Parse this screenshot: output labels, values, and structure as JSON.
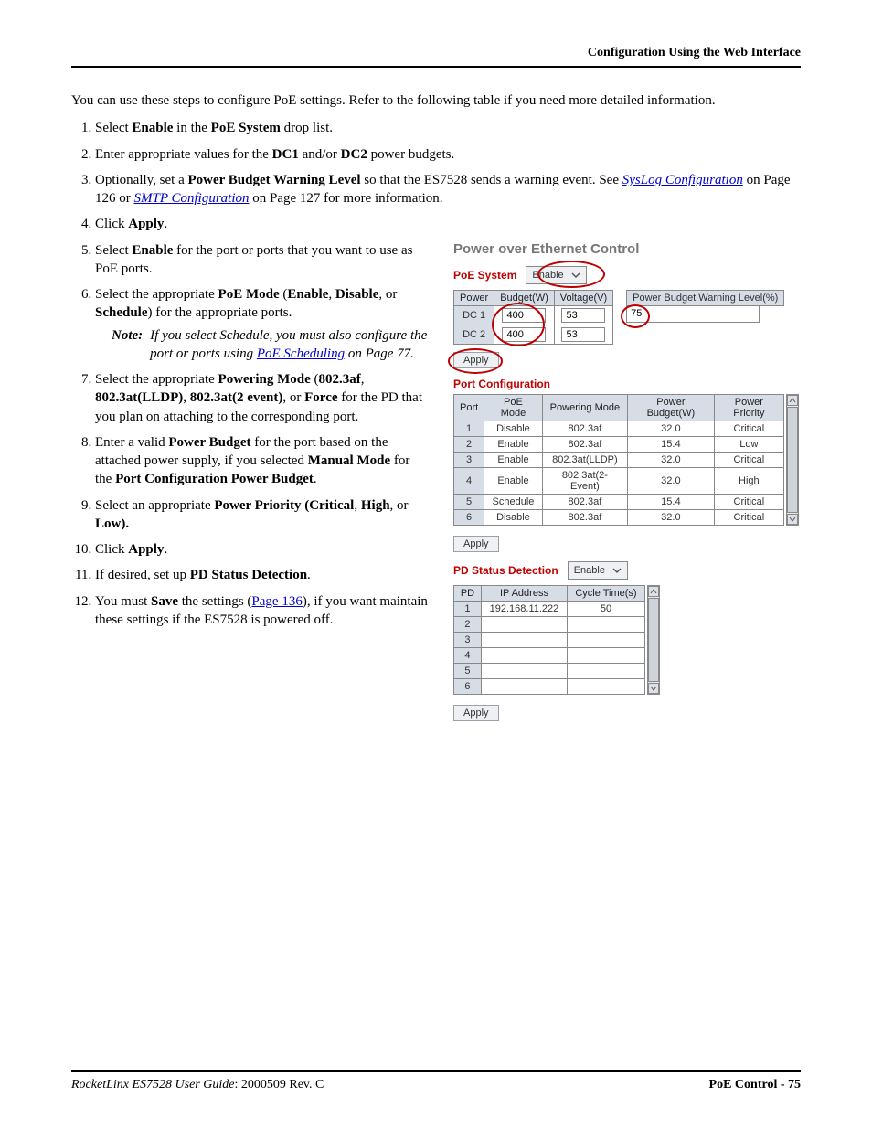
{
  "header": {
    "right": "Configuration Using the Web Interface"
  },
  "intro": "You can use these steps to configure PoE settings. Refer to the following table if you need more detailed information.",
  "links": {
    "syslog": "SysLog Configuration",
    "smtp": "SMTP Configuration",
    "poe_sched": "PoE Scheduling",
    "page136": "Page 136"
  },
  "steps_top": {
    "s1_a": "Select ",
    "s1_b": "Enable",
    "s1_c": " in the ",
    "s1_d": "PoE System",
    "s1_e": " drop list.",
    "s2_a": "Enter appropriate values for the ",
    "s2_b": "DC1",
    "s2_c": " and/or ",
    "s2_d": "DC2",
    "s2_e": " power budgets.",
    "s3_a": "Optionally, set a ",
    "s3_b": "Power Budget Warning Level",
    "s3_c": " so that the ES7528 sends a warning event. See ",
    "s3_d": " on Page 126 or ",
    "s3_e": " on Page 127 for more information.",
    "s4_a": "Click ",
    "s4_b": "Apply",
    "s4_c": "."
  },
  "steps_left": {
    "s5_a": "Select ",
    "s5_b": "Enable",
    "s5_c": " for the port or ports that you want to use as PoE ports.",
    "s6_a": "Select the appropriate ",
    "s6_b": "PoE Mode",
    "s6_c": " (",
    "s6_d": "Enable",
    "s6_e": ", ",
    "s6_f": "Disable",
    "s6_g": ", or ",
    "s6_h": "Schedule",
    "s6_i": ") for the appropriate ports.",
    "note_label": "Note:",
    "note_a": "If you select Schedule, you must also configure the port or ports using ",
    "note_b": " on Page 77.",
    "s7_a": "Select the appropriate ",
    "s7_b": "Powering Mode",
    "s7_c": " (",
    "s7_d": "802.3af",
    "s7_e": ", ",
    "s7_f": "802.3at(LLDP)",
    "s7_g": ", ",
    "s7_h": "802.3at(2 event)",
    "s7_i": ", or ",
    "s7_j": "Force",
    "s7_k": " for the PD that you plan on attaching to the corresponding port.",
    "s8_a": "Enter a valid ",
    "s8_b": "Power Budget",
    "s8_c": " for the port based on the attached power supply, if you selected ",
    "s8_d": "Manual Mode",
    "s8_e": " for the ",
    "s8_f": "Port Configuration Power Budget",
    "s8_g": ".",
    "s9_a": "Select an appropriate ",
    "s9_b": "Power Priority (Critical",
    "s9_c": ", ",
    "s9_d": "High",
    "s9_e": ", or ",
    "s9_f": "Low).",
    "s10_a": "Click ",
    "s10_b": "Apply",
    "s10_c": ".",
    "s11": "If desired, set up ",
    "s11_b": "PD Status Detection",
    "s11_c": ".",
    "s12_a": "You must ",
    "s12_b": "Save",
    "s12_c": " the settings (",
    "s12_d": "), if you want maintain these settings if the ES7528 is powered off."
  },
  "ss": {
    "title": "Power over Ethernet Control",
    "poe_system_label": "PoE System",
    "poe_system_value": "Enable",
    "sys_headers": {
      "power": "Power",
      "budget": "Budget(W)",
      "voltage": "Voltage(V)"
    },
    "sys_rows": [
      {
        "power": "DC 1",
        "budget": "400",
        "voltage": "53"
      },
      {
        "power": "DC 2",
        "budget": "400",
        "voltage": "53"
      }
    ],
    "warn_label": "Power Budget Warning Level(%)",
    "warn_value": "75",
    "apply": "Apply",
    "port_cfg": "Port Configuration",
    "port_headers": {
      "port": "Port",
      "mode": "PoE Mode",
      "pmode": "Powering Mode",
      "budget": "Power Budget(W)",
      "prio": "Power Priority"
    },
    "port_rows": [
      {
        "port": "1",
        "mode": "Disable",
        "pmode": "802.3af",
        "budget": "32.0",
        "prio": "Critical"
      },
      {
        "port": "2",
        "mode": "Enable",
        "pmode": "802.3af",
        "budget": "15.4",
        "prio": "Low"
      },
      {
        "port": "3",
        "mode": "Enable",
        "pmode": "802.3at(LLDP)",
        "budget": "32.0",
        "prio": "Critical"
      },
      {
        "port": "4",
        "mode": "Enable",
        "pmode": "802.3at(2-Event)",
        "budget": "32.0",
        "prio": "High"
      },
      {
        "port": "5",
        "mode": "Schedule",
        "pmode": "802.3af",
        "budget": "15.4",
        "prio": "Critical"
      },
      {
        "port": "6",
        "mode": "Disable",
        "pmode": "802.3af",
        "budget": "32.0",
        "prio": "Critical"
      }
    ],
    "pd_label": "PD Status Detection",
    "pd_value": "Enable",
    "pd_headers": {
      "pd": "PD",
      "ip": "IP Address",
      "cycle": "Cycle Time(s)"
    },
    "pd_rows": [
      {
        "pd": "1",
        "ip": "192.168.11.222",
        "cycle": "50"
      },
      {
        "pd": "2",
        "ip": "",
        "cycle": ""
      },
      {
        "pd": "3",
        "ip": "",
        "cycle": ""
      },
      {
        "pd": "4",
        "ip": "",
        "cycle": ""
      },
      {
        "pd": "5",
        "ip": "",
        "cycle": ""
      },
      {
        "pd": "6",
        "ip": "",
        "cycle": ""
      }
    ]
  },
  "footer": {
    "left_a": "RocketLinx ES7528  User Guide",
    "left_b": ": 2000509 Rev. C",
    "right": "PoE Control - 75"
  }
}
